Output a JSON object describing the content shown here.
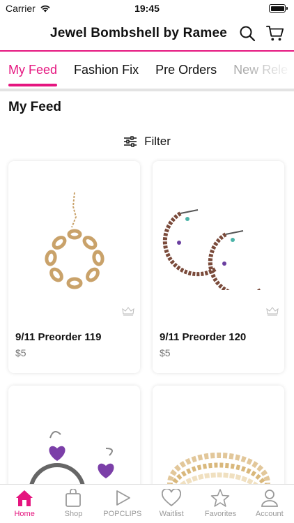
{
  "status_bar": {
    "carrier": "Carrier",
    "time": "19:45"
  },
  "header": {
    "title": "Jewel Bombshell by Ramee"
  },
  "tabs": [
    {
      "label": "My Feed"
    },
    {
      "label": "Fashion Fix"
    },
    {
      "label": "Pre Orders"
    },
    {
      "label": "New Rele"
    }
  ],
  "section_title": "My Feed",
  "filter_label": "Filter",
  "products": [
    {
      "name": "9/11 Preorder 119",
      "price": "$5"
    },
    {
      "name": "9/11 Preorder 120",
      "price": "$5"
    }
  ],
  "tabbar": [
    {
      "label": "Home",
      "icon": "home-icon"
    },
    {
      "label": "Shop",
      "icon": "bag-icon"
    },
    {
      "label": "POPCLIPS",
      "icon": "play-icon"
    },
    {
      "label": "Waitlist",
      "icon": "heart-icon"
    },
    {
      "label": "Favorites",
      "icon": "star-icon"
    },
    {
      "label": "Account",
      "icon": "person-icon"
    }
  ],
  "colors": {
    "accent": "#e5157f"
  }
}
